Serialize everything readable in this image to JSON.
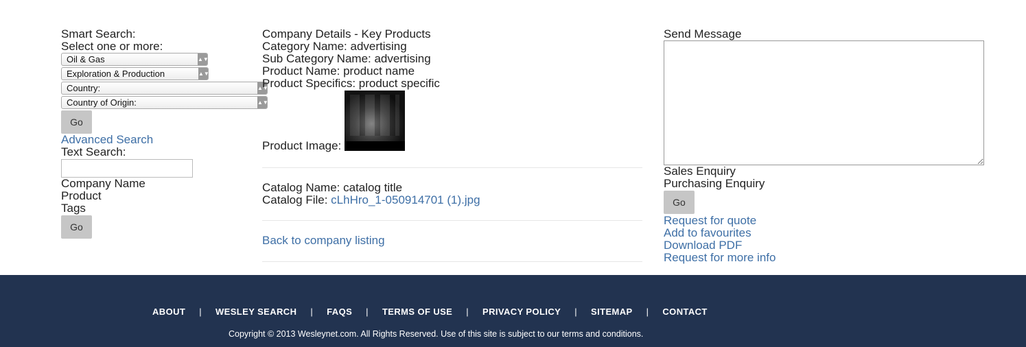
{
  "smart_search": {
    "title": "Smart Search:",
    "subtitle": "Select one or more:",
    "selects": [
      {
        "value": "Oil & Gas"
      },
      {
        "value": "Exploration & Production"
      },
      {
        "value": "Country:"
      },
      {
        "value": "Country of Origin:"
      }
    ],
    "go_label": "Go",
    "advanced_search_label": "Advanced Search",
    "text_search_label": "Text Search:",
    "text_search_value": "",
    "options": [
      "Company Name",
      "Product",
      "Tags"
    ],
    "go2_label": "Go"
  },
  "details": {
    "heading": "Company Details - Key Products",
    "category": "Category Name: advertising",
    "sub_category": "Sub Category Name: advertising",
    "product_name": "Product Name: product name",
    "product_specifics": "Product Specifics: product specific",
    "product_image_label": "Product Image:",
    "catalog_name": "Catalog Name: catalog title",
    "catalog_file_label": "Catalog File:",
    "catalog_file_link": "cLhHro_1-050914701 (1).jpg",
    "back_link": "Back to company listing"
  },
  "message": {
    "title": "Send Message",
    "textarea_value": "",
    "enquiry_options": [
      "Sales Enquiry",
      "Purchasing Enquiry"
    ],
    "go_label": "Go",
    "links": [
      "Request for quote",
      "Add to favourites",
      "Download PDF",
      "Request for more info"
    ]
  },
  "footer": {
    "nav": [
      "ABOUT",
      "WESLEY SEARCH",
      "FAQS",
      "TERMS OF USE",
      "PRIVACY POLICY",
      "SITEMAP",
      "CONTACT"
    ],
    "separator": "|",
    "copyright": "Copyright © 2013 Wesleynet.com. All Rights Reserved. Use of this site is subject to our terms and conditions."
  },
  "colors": {
    "link": "#3e6fa6",
    "footer_bg": "#223350",
    "button_bg": "#c6c6c6"
  }
}
